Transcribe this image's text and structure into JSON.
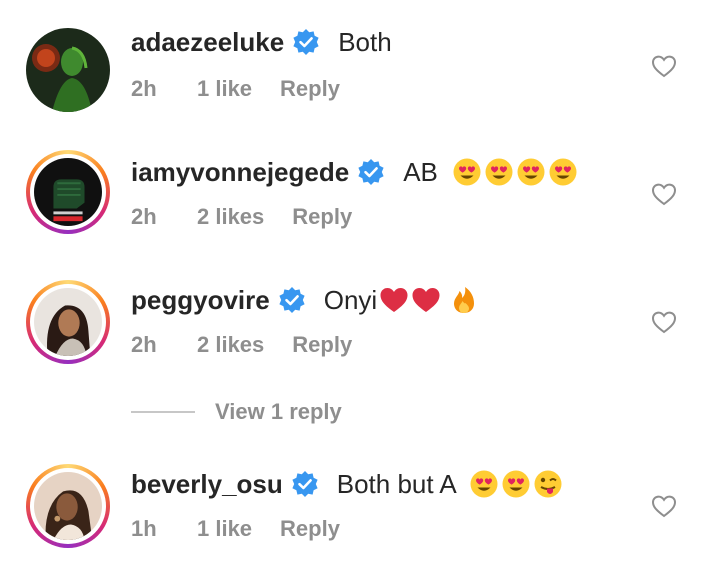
{
  "comments": [
    {
      "username": "adaezeeluke",
      "text": "Both",
      "emojis": [],
      "time": "2h",
      "likes": "1 like",
      "reply": "Reply",
      "avatar_ring": false,
      "avatar_icon": "avatar-green-portrait"
    },
    {
      "username": "iamyvonnejegede",
      "text": "AB",
      "emojis": [
        "heart-eyes-emoji",
        "heart-eyes-emoji",
        "heart-eyes-emoji",
        "heart-eyes-emoji"
      ],
      "time": "2h",
      "likes": "2 likes",
      "reply": "Reply",
      "avatar_ring": true,
      "avatar_icon": "avatar-endsars-fist"
    },
    {
      "username": "peggyovire",
      "text": "Onyi",
      "emojis": [
        "red-heart-emoji",
        "red-heart-emoji",
        "fire-emoji"
      ],
      "time": "2h",
      "likes": "2 likes",
      "reply": "Reply",
      "avatar_ring": true,
      "avatar_icon": "avatar-portrait"
    },
    {
      "username": "beverly_osu",
      "text": "Both but A",
      "emojis": [
        "heart-eyes-emoji",
        "heart-eyes-emoji",
        "winking-tongue-emoji"
      ],
      "time": "1h",
      "likes": "1 like",
      "reply": "Reply",
      "avatar_ring": true,
      "avatar_icon": "avatar-portrait"
    }
  ],
  "view_replies": "View 1 reply",
  "colors": {
    "text": "#262626",
    "secondary": "#8e8e8e",
    "verified": "#3897f0"
  }
}
